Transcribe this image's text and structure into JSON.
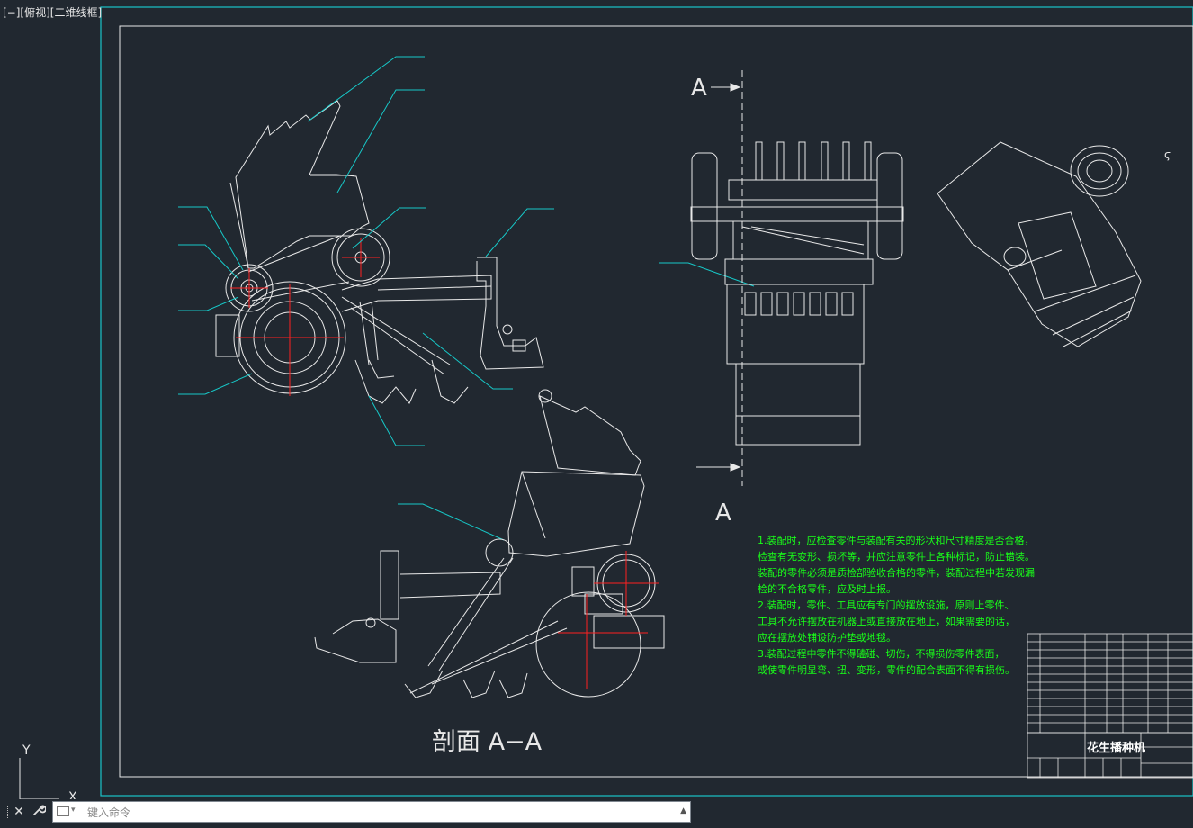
{
  "viewport": {
    "label": "[−][俯视][二维线框]"
  },
  "drawing": {
    "title_block_title": "花生播种机",
    "section_marker_top": "A",
    "section_marker_bottom": "A",
    "section_title": "剖面 A−A",
    "notes": [
      "1.装配时，应检查零件与装配有关的形状和尺寸精度是否合格，",
      "检查有无变形、损坏等，并应注意零件上各种标记，防止错装。",
      "装配的零件必须是质检部验收合格的零件，装配过程中若发现漏",
      "检的不合格零件，应及时上报。",
      "2.装配时，零件、工具应有专门的摆放设施，原则上零件、",
      "工具不允许摆放在机器上或直接放在地上，如果需要的话，",
      "应在摆放处铺设防护垫或地毯。",
      "3.装配过程中零件不得磕碰、切伤，不得损伤零件表面，",
      "或使零件明显弯、扭、变形，零件的配合表面不得有损伤。"
    ],
    "ucs_y": "Y",
    "ucs_x": "X"
  },
  "command_line": {
    "placeholder": "键入命令",
    "close_glyph": "✕",
    "customize_glyph": "🔧",
    "scroll_glyph": "▲"
  },
  "colors": {
    "background": "#212830",
    "frame_cyan": "#19c3c8",
    "line_white": "#e8e8e8",
    "center_red": "#ff2020",
    "note_green": "#19ff19",
    "leader_cyan": "#17c8c8"
  }
}
